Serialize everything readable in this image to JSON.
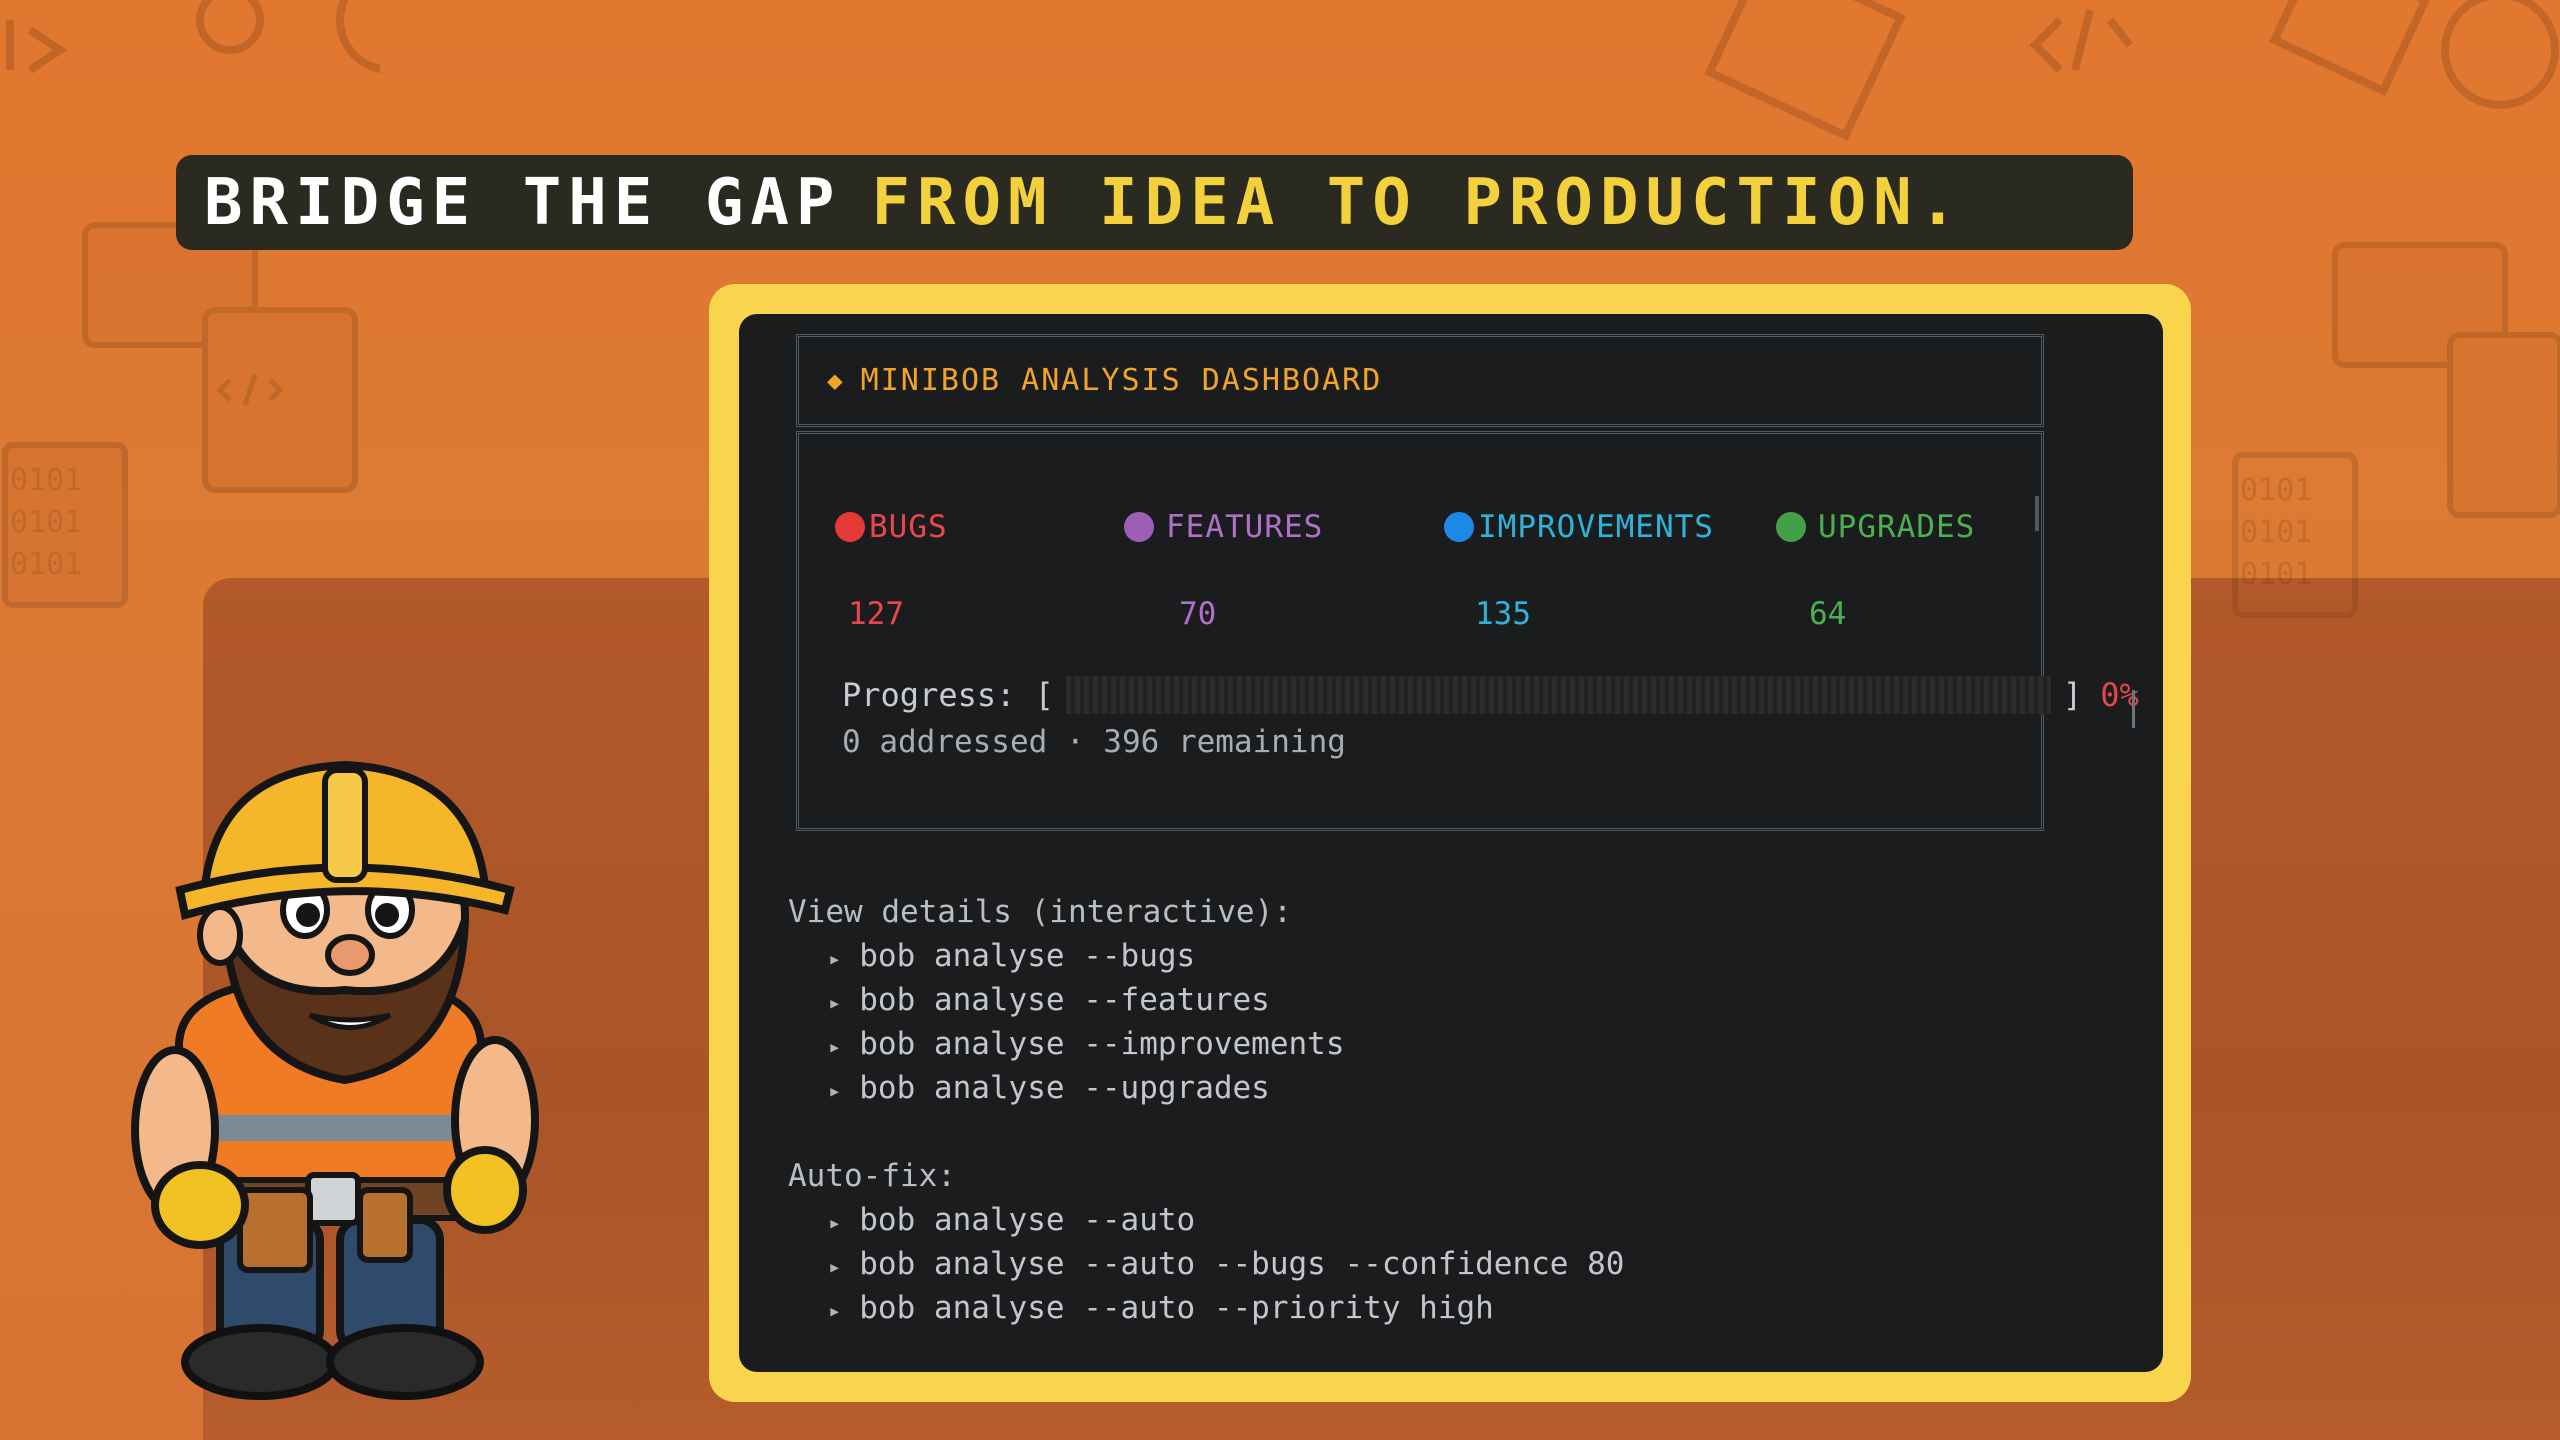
{
  "headline": {
    "part1": "BRIDGE THE GAP",
    "part2": "FROM IDEA TO PRODUCTION."
  },
  "dashboard": {
    "title": "MINIBOB ANALYSIS DASHBOARD",
    "stats": [
      {
        "label": "BUGS",
        "value": "127",
        "color": "#e53935"
      },
      {
        "label": "FEATURES",
        "value": "70",
        "color": "#9c5fb5"
      },
      {
        "label": "IMPROVEMENTS",
        "value": "135",
        "color": "#1e88e5"
      },
      {
        "label": "UPGRADES",
        "value": "64",
        "color": "#43a047"
      }
    ],
    "progress_label": "Progress: [",
    "progress_close": "]",
    "progress_percent": "0%",
    "progress_fraction": 0,
    "summary": "0 addressed · 396 remaining"
  },
  "details": {
    "heading": "View details (interactive):",
    "commands": [
      "bob analyse --bugs",
      "bob analyse --features",
      "bob analyse --improvements",
      "bob analyse --upgrades"
    ]
  },
  "autofix": {
    "heading": "Auto-fix:",
    "commands": [
      "bob analyse --auto",
      "bob analyse --auto --bugs --confidence 80",
      "bob analyse --auto --priority high"
    ]
  }
}
